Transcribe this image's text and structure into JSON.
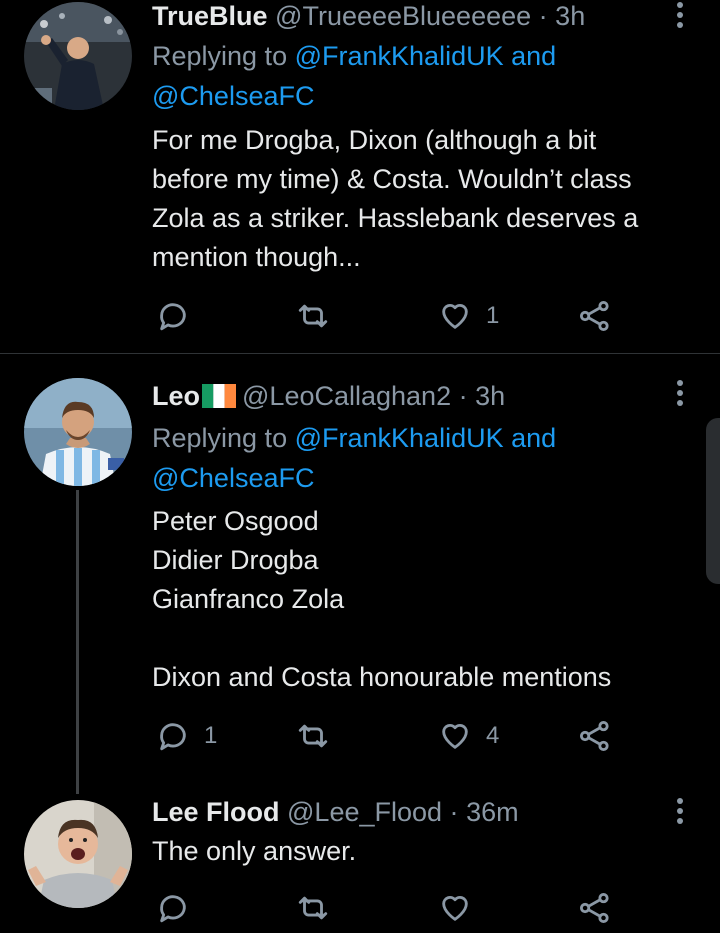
{
  "theme": {
    "background": "#000000",
    "text": "#e7e9ea",
    "muted": "#8b98a5",
    "link": "#1d9bf0",
    "divider": "#2f3336"
  },
  "tweets": [
    {
      "name": "TrueBlue",
      "handle": "@TrueeeeBlueeeeee",
      "dot": "·",
      "time": "3h",
      "replying_prefix": "Replying to",
      "mention_1": "@FrankKhalidUK",
      "and_text": "and",
      "mention_2": "@ChelseaFC",
      "lines": [
        "For me Drogba, Dixon (although a bit",
        "before my time) & Costa. Wouldn’t class",
        "Zola as a striker. Hasslebank deserves a",
        "mention though..."
      ],
      "actions": {
        "reply_count": "",
        "retweet_count": "",
        "like_count": "1"
      }
    },
    {
      "name": "Leo",
      "flag": "ireland-flag",
      "handle": "@LeoCallaghan2",
      "dot": "·",
      "time": "3h",
      "replying_prefix": "Replying to",
      "mention_1": "@FrankKhalidUK",
      "and_text": "and",
      "mention_2": "@ChelseaFC",
      "lines": [
        "Peter Osgood",
        "Didier Drogba",
        "Gianfranco Zola",
        "",
        "Dixon and Costa honourable mentions"
      ],
      "actions": {
        "reply_count": "1",
        "retweet_count": "",
        "like_count": "4"
      }
    },
    {
      "name": "Lee Flood",
      "handle": "@Lee_Flood",
      "dot": "·",
      "time": "36m",
      "lines": [
        "The only answer."
      ],
      "actions": {
        "reply_count": "",
        "retweet_count": "",
        "like_count": ""
      }
    }
  ],
  "icons": {
    "more": "more-vertical-icon",
    "reply": "reply-icon",
    "retweet": "retweet-icon",
    "like": "heart-icon",
    "share": "share-icon"
  }
}
